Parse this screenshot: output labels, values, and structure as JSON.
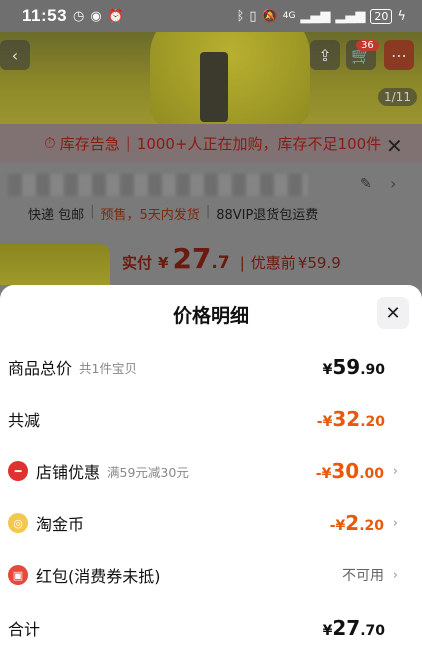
{
  "status_bar": {
    "time": "11:53",
    "left_icons": [
      "notification-icon",
      "eye-icon",
      "alarm-icon"
    ],
    "right_icons": [
      "bluetooth-icon",
      "vibrate-icon",
      "mute-icon",
      "signal-icon",
      "signal-icon"
    ],
    "network_label": "4G",
    "battery": "20"
  },
  "background_page": {
    "cart_count": "36",
    "image_counter": "1/11",
    "stock_warning": {
      "title": "库存告急",
      "message": "1000+人正在加购，库存不足100件"
    },
    "tags": [
      "快递 包邮",
      "预售，5天内发货",
      "88VIP退货包运费"
    ],
    "price": {
      "label": "实付",
      "currency": "¥",
      "integer": "27",
      "decimal": ".7",
      "before_label": "优惠前",
      "before_price": "¥59.9"
    }
  },
  "sheet": {
    "title": "价格明细",
    "rows": [
      {
        "name": "商品总价",
        "sub": "共1件宝贝",
        "sym": "¥",
        "int": "59",
        "dec": ".90"
      },
      {
        "name": "共减",
        "sub": "",
        "sym": "-¥",
        "int": "32",
        "dec": ".20"
      },
      {
        "name": "店铺优惠",
        "sub": "满59元减30元",
        "sym": "-¥",
        "int": "30",
        "dec": ".00"
      },
      {
        "name": "淘金币",
        "sub": "",
        "sym": "-¥",
        "int": "2",
        "dec": ".20"
      },
      {
        "name": "红包(消费券未抵)",
        "sub": "",
        "value": "不可用"
      },
      {
        "name": "合计",
        "sub": "",
        "sym": "¥",
        "int": "27",
        "dec": ".70"
      }
    ]
  },
  "colors": {
    "accent_orange": "#e8590c",
    "warning_red": "#8c1a12",
    "sheet_bg": "#ffffff"
  }
}
